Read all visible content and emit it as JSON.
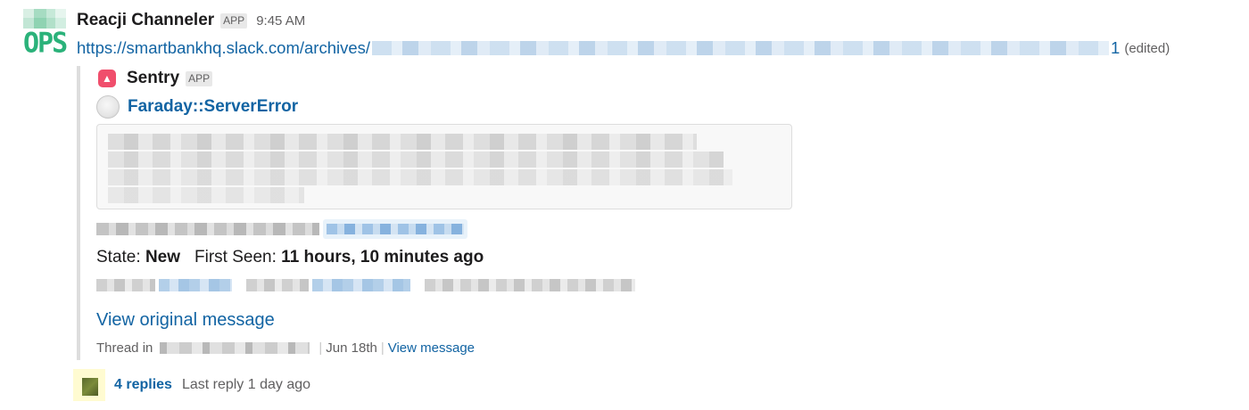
{
  "message": {
    "sender": "Reacji Channeler",
    "app_badge": "APP",
    "time": "9:45 AM",
    "avatar_text": "OPS",
    "link_prefix": "https://smartbankhq.slack.com/archives/",
    "link_suffix": "1",
    "edited": "(edited)"
  },
  "attachment": {
    "service_name": "Sentry",
    "service_badge": "APP",
    "title": "Faraday::ServerError",
    "state_label": "State:",
    "state_value": "New",
    "first_seen_label": "First Seen:",
    "first_seen_value": "11 hours, 10 minutes ago",
    "view_original": "View original message",
    "thread_in": "Thread in",
    "thread_date": "Jun 18th",
    "view_message": "View message"
  },
  "thread": {
    "replies": "4 replies",
    "last_reply": "Last reply 1 day ago"
  },
  "colors": {
    "link": "#1264a3",
    "sentry": "#f04e6c",
    "ops_green": "#2bb27a"
  }
}
